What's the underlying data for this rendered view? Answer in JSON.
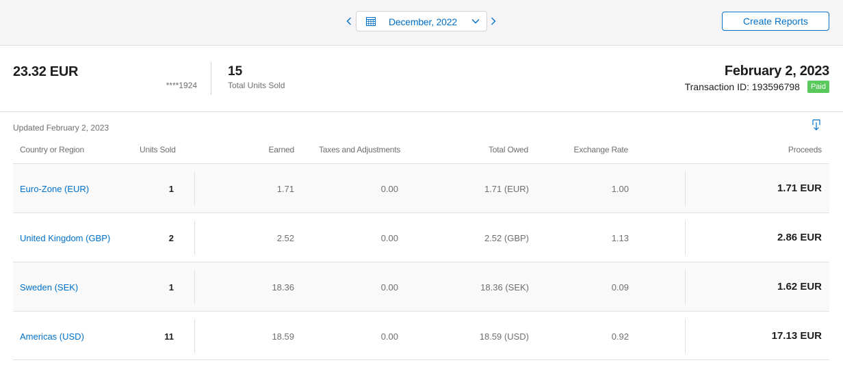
{
  "toolbar": {
    "period": "December, 2022",
    "create_reports": "Create Reports"
  },
  "summary": {
    "amount": "23.32 EUR",
    "account": "****1924",
    "units_count": "15",
    "units_label": "Total Units Sold",
    "date": "February 2, 2023",
    "transaction": "Transaction ID: 193596798",
    "status": "Paid"
  },
  "updated": "Updated February 2, 2023",
  "table": {
    "headers": {
      "country": "Country or Region",
      "units": "Units Sold",
      "earned": "Earned",
      "taxes": "Taxes and Adjustments",
      "owed": "Total Owed",
      "rate": "Exchange Rate",
      "proceeds": "Proceeds"
    },
    "rows": [
      {
        "country": "Euro-Zone (EUR)",
        "units": "1",
        "earned": "1.71",
        "taxes": "0.00",
        "owed": "1.71 (EUR)",
        "rate": "1.00",
        "proceeds": "1.71 EUR"
      },
      {
        "country": "United Kingdom (GBP)",
        "units": "2",
        "earned": "2.52",
        "taxes": "0.00",
        "owed": "2.52 (GBP)",
        "rate": "1.13",
        "proceeds": "2.86 EUR"
      },
      {
        "country": "Sweden (SEK)",
        "units": "1",
        "earned": "18.36",
        "taxes": "0.00",
        "owed": "18.36 (SEK)",
        "rate": "0.09",
        "proceeds": "1.62 EUR"
      },
      {
        "country": "Americas (USD)",
        "units": "11",
        "earned": "18.59",
        "taxes": "0.00",
        "owed": "18.59 (USD)",
        "rate": "0.92",
        "proceeds": "17.13 EUR"
      }
    ]
  },
  "icons": {
    "prev": "chevron-left-icon",
    "next": "chevron-right-icon",
    "calendar": "calendar-icon",
    "dropdown": "chevron-down-icon",
    "download": "download-icon"
  },
  "colors": {
    "accent": "#0070c9",
    "paid": "#5ac95c"
  }
}
